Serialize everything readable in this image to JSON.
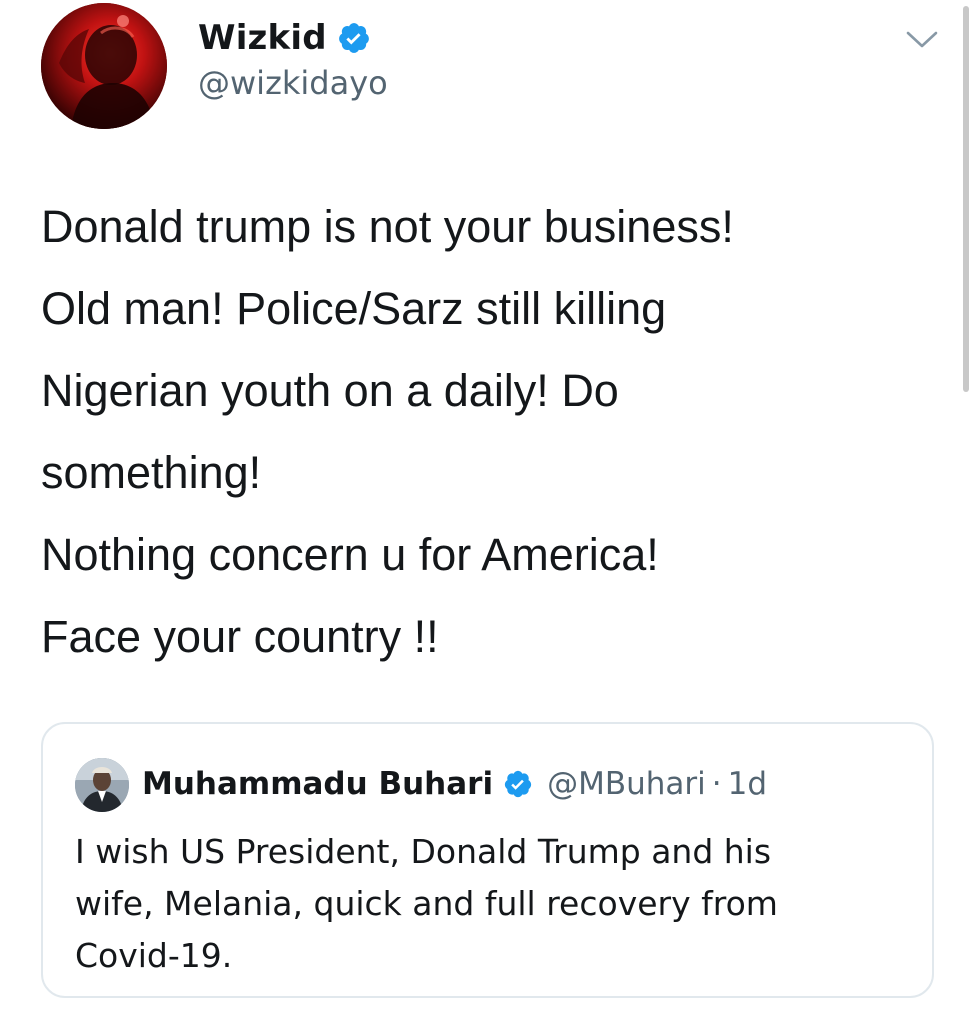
{
  "author": {
    "display_name": "Wizkid",
    "handle": "@wizkidayo",
    "avatar_icon": "user-avatar-red",
    "verified": true
  },
  "tweet": {
    "lines": [
      "Donald trump is not your business!",
      "Old man! Police/Sarz still killing",
      "Nigerian youth on a daily! Do",
      "something!",
      "Nothing concern u for America!",
      "Face your country !!"
    ]
  },
  "menu": {
    "icon": "chevron-down-icon"
  },
  "quoted_tweet": {
    "display_name": "Muhammadu Buhari",
    "handle": "@MBuhari",
    "separator": "·",
    "time": "1d",
    "verified": true,
    "lines": [
      "I wish US President, Donald Trump and his",
      "wife, Melania, quick and full recovery from",
      "Covid-19."
    ]
  },
  "colors": {
    "verified_blue": "#1d9bf0",
    "text_primary": "#14171a",
    "text_secondary": "#536471",
    "border": "#e1e8ed"
  }
}
